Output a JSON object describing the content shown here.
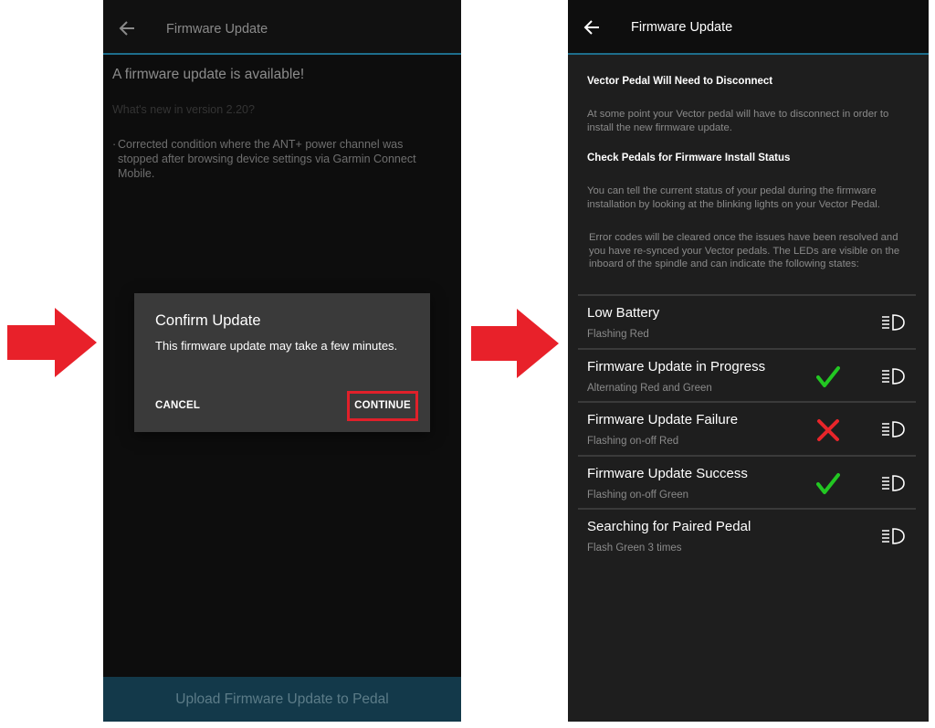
{
  "left_screen": {
    "header": {
      "title": "Firmware Update"
    },
    "headline": "A firmware update is available!",
    "whats_new": "What's new in version 2.20?",
    "release_notes": [
      "Corrected condition where the ANT+ power channel was stopped after browsing device settings via Garmin Connect Mobile."
    ],
    "dialog": {
      "title": "Confirm Update",
      "message": "This firmware update may take a few minutes.",
      "cancel_label": "CANCEL",
      "continue_label": "CONTINUE"
    },
    "upload_button_label": "Upload Firmware Update to Pedal"
  },
  "right_screen": {
    "header": {
      "title": "Firmware Update"
    },
    "section_disconnect": {
      "title": "Vector Pedal Will Need to Disconnect",
      "body": "At some point your Vector pedal will have to disconnect in order to install the new firmware update."
    },
    "section_status": {
      "title": "Check Pedals for Firmware Install Status",
      "body": "You can tell the current status of your pedal during the firmware installation by looking at the blinking lights on your Vector Pedal.",
      "body2": "Error codes will be cleared once the issues have been resolved and you have re-synced your Vector pedals. The LEDs are visible on the inboard of the spindle and can indicate the following states:"
    },
    "status_rows": [
      {
        "name": "Low Battery",
        "description": "Flashing Red",
        "mark": "none"
      },
      {
        "name": "Firmware Update in Progress",
        "description": "Alternating Red and Green",
        "mark": "check"
      },
      {
        "name": "Firmware Update Failure",
        "description": "Flashing on-off Red",
        "mark": "cross"
      },
      {
        "name": "Firmware Update Success",
        "description": "Flashing on-off Green",
        "mark": "check"
      },
      {
        "name": "Searching for Paired Pedal",
        "description": "Flash Green 3 times",
        "mark": "none"
      }
    ]
  },
  "icons": {
    "back": "back-arrow-icon",
    "led": "led-light-icon",
    "check": "green-check-icon",
    "cross": "red-x-icon",
    "step_arrow": "red-right-arrow-icon"
  },
  "colors": {
    "accent_line": "#1e6e8c",
    "highlight_red": "#e0202a",
    "check_green": "#22c722",
    "cross_red": "#e8252a",
    "upload_button_bg": "#13394a"
  }
}
